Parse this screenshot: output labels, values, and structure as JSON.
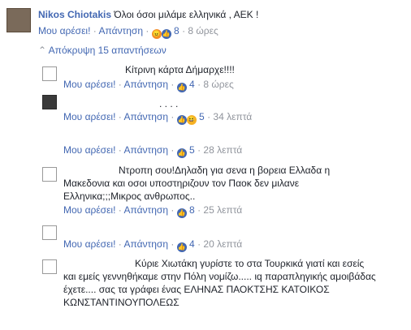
{
  "top_comment": {
    "author": "Nikos Chiotakis",
    "text": "Όλοι όσοι μιλάμε ελληνικά , ΑΕΚ !",
    "like_label": "Μου αρέσει!",
    "reply_label": "Απάντηση",
    "reactions_count": "8",
    "time": "8 ώρες",
    "reactions": [
      "angry-icon",
      "like-icon"
    ]
  },
  "hide_replies_label": "Απόκρυψη 15 απαντήσεων",
  "replies": [
    {
      "author": "",
      "lines": [
        "Κίτρινη κάρτα Δήμαρχε!!!!"
      ],
      "like_label": "Μου αρέσει!",
      "reply_label": "Απάντηση",
      "reactions_count": "4",
      "time": "8 ώρες",
      "reactions": [
        "like-icon"
      ]
    },
    {
      "author": "",
      "lines": [
        ". .  .                        ."
      ],
      "like_label": "Μου αρέσει!",
      "reply_label": "Απάντηση",
      "reactions_count": "5",
      "time": "34 λεπτά",
      "reactions": [
        "like-icon",
        "laugh-icon"
      ]
    },
    {
      "author": "",
      "lines": [],
      "like_label": "Μου αρέσει!",
      "reply_label": "Απάντηση",
      "reactions_count": "5",
      "time": "28 λεπτά",
      "reactions": [
        "like-icon"
      ]
    },
    {
      "author": "",
      "lines": [
        "Ντροπη σου!Δηλαδη για σενα η βορεια Ελλαδα η",
        "Μακεδονια και οσοι υποστηριζουν τον Παοκ δεν μιλανε",
        "Ελληνικα;;;Μικρος ανθρωπος.."
      ],
      "like_label": "Μου αρέσει!",
      "reply_label": "Απάντηση",
      "reactions_count": "8",
      "time": "25 λεπτά",
      "reactions": [
        "like-icon"
      ]
    },
    {
      "author": "",
      "lines": [],
      "like_label": "Μου αρέσει!",
      "reply_label": "Απάντηση",
      "reactions_count": "4",
      "time": "20 λεπτά",
      "reactions": [
        "like-icon"
      ]
    },
    {
      "author": "",
      "lines": [
        "Κύριε Χιωτάκη γυρίστε το στα Τουρκικά γιατί και εσείς",
        "και εμείς γεννηθήκαμε στην Πόλη νομίζω..... ιq παραπληγικής αμοιβάδας",
        "έχετε.... σας τα γράφει ένας ΕΛΗΝΑΣ ΠΑΟΚΤΣΗΣ ΚΑΤΟΙΚΟΣ",
        "ΚΩΝΣΤΑΝΤΙΝΟΥΠΟΛΕΩΣ"
      ]
    }
  ]
}
